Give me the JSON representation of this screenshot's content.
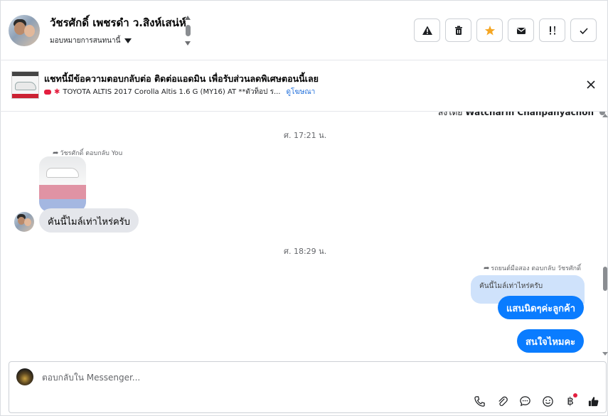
{
  "header": {
    "contact_name": "วัชรศักดิ์ เพชรดำ ว.สิงห์เสน่ห์",
    "assign_label": "มอบหมายการสนทนานี้",
    "actions": [
      "warning-icon",
      "trash-icon",
      "star-icon",
      "mail-icon",
      "important-icon",
      "check-icon"
    ],
    "star_color": "#f5a623"
  },
  "ad": {
    "title": "แชทนี้มีข้อความตอบกลับต่อ ติดต่อแอดมิน เพื่อรับส่วนลดพิเศษตอนนี้เลย",
    "subtitle": "TOYOTA ALTIS 2017 Corolla Altis 1.6 G (MY16) AT **ตัวท็อป ร...",
    "link": "ดูโฆษณา"
  },
  "conversation": {
    "sent_by_prefix": "ส่งโดย",
    "sent_by_name": "Watcharin Chanpanyachon",
    "timestamp_1": "ศ. 17:21 น.",
    "reply_meta_1": "วัชรศักดิ์ ตอบกลับ You",
    "incoming_message": "คันนี้ไมล์เท่าไหร่ครับ",
    "timestamp_2": "ศ. 18:29 น.",
    "reply_meta_2": "รถยนต์มือสอง ตอบกลับ วัชรศักดิ์",
    "quoted_message": "คันนี้ไมล์เท่าไหร่ครับ",
    "outgoing_1": "แสนนิดๆค่ะลูกค้า",
    "outgoing_2": "สนใจไหมคะ",
    "outgoing_color": "#0a7cff"
  },
  "composer": {
    "placeholder": "ตอบกลับใน Messenger...",
    "tools": [
      "phone-icon",
      "attachment-icon",
      "chat-bubble-icon",
      "emoji-icon",
      "baht-icon",
      "thumbs-up-icon"
    ]
  }
}
